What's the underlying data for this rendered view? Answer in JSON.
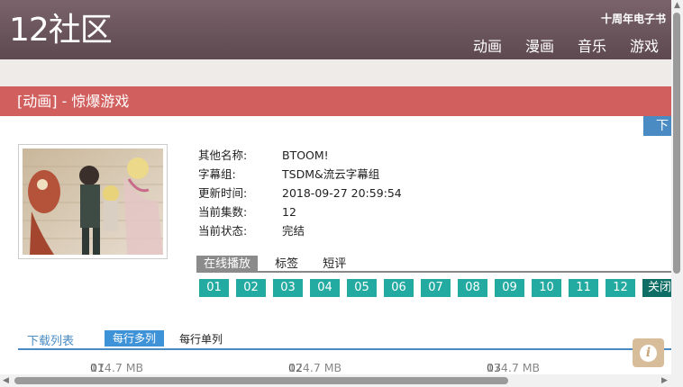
{
  "header": {
    "logo": "12社区",
    "tagline": "十周年电子书",
    "nav": [
      "动画",
      "漫画",
      "音乐",
      "游戏"
    ]
  },
  "page_title": "[动画] - 惊爆游戏",
  "download_tab_label": "下载",
  "info": [
    {
      "key": "其他名称:",
      "value": "BTOOM!"
    },
    {
      "key": "字幕组:",
      "value": "TSDM&流云字幕组"
    },
    {
      "key": "更新时间:",
      "value": "2018-09-27 20:59:54"
    },
    {
      "key": "当前集数:",
      "value": "12"
    },
    {
      "key": "当前状态:",
      "value": "完结"
    }
  ],
  "tabs": [
    "在线播放",
    "标签",
    "短评"
  ],
  "episodes": [
    "01",
    "02",
    "03",
    "04",
    "05",
    "06",
    "07",
    "08",
    "09",
    "10",
    "11",
    "12"
  ],
  "close_label": "关闭",
  "download_list": {
    "title": "下载列表",
    "option_multi": "每行多列",
    "option_single": "每行单列",
    "files": [
      {
        "ep": "01",
        "size": "174.7 MB"
      },
      {
        "ep": "02",
        "size": "174.7 MB"
      },
      {
        "ep": "03",
        "size": "174.7 MB"
      }
    ]
  },
  "colors": {
    "header": "#6b5860",
    "title_bar": "#d05f5e",
    "episode": "#23aaa1",
    "accent_blue": "#4a8bc4"
  },
  "icons": {
    "info_button": "info-icon"
  }
}
